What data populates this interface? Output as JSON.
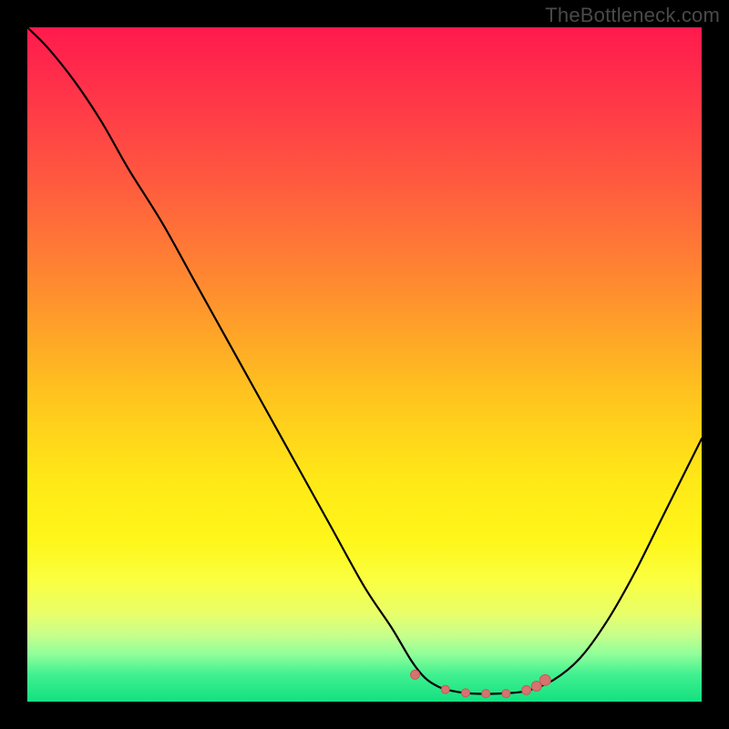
{
  "watermark": "TheBottleneck.com",
  "colors": {
    "curve_stroke": "#000000",
    "marker_fill": "#d6736f",
    "marker_stroke": "#c45b57"
  },
  "chart_data": {
    "type": "line",
    "title": "",
    "xlabel": "",
    "ylabel": "",
    "xlim": [
      0,
      100
    ],
    "ylim": [
      0,
      100
    ],
    "grid": false,
    "curve": {
      "x": [
        0,
        3,
        7,
        11,
        15,
        20,
        25,
        30,
        35,
        40,
        45,
        50,
        54,
        57,
        59,
        61,
        63,
        66,
        70,
        74,
        78,
        82,
        86,
        90,
        94,
        98,
        100
      ],
      "y": [
        100,
        97,
        92,
        86,
        79,
        71,
        62,
        53,
        44,
        35,
        26,
        17,
        11,
        6,
        3.5,
        2.2,
        1.6,
        1.2,
        1.2,
        1.6,
        3.2,
        6.5,
        12,
        19,
        27,
        35,
        39
      ]
    },
    "markers": {
      "x": [
        57.5,
        62,
        65,
        68,
        71,
        74,
        75.5,
        76.8
      ],
      "y": [
        4.0,
        1.8,
        1.3,
        1.2,
        1.2,
        1.7,
        2.3,
        3.2
      ],
      "r": [
        5,
        4.5,
        4.5,
        4.5,
        4.5,
        5,
        5.5,
        6
      ]
    }
  }
}
